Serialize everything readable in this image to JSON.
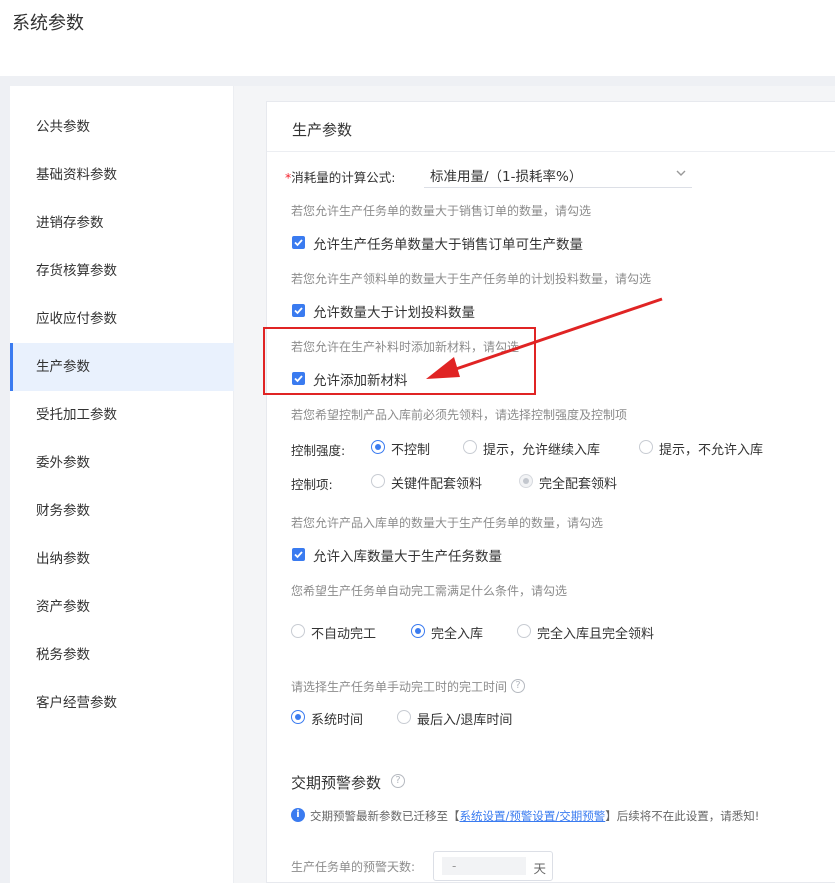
{
  "page_title": "系统参数",
  "sidebar": {
    "items": [
      {
        "label": "公共参数"
      },
      {
        "label": "基础资料参数"
      },
      {
        "label": "进销存参数"
      },
      {
        "label": "存货核算参数"
      },
      {
        "label": "应收应付参数"
      },
      {
        "label": "生产参数"
      },
      {
        "label": "受托加工参数"
      },
      {
        "label": "委外参数"
      },
      {
        "label": "财务参数"
      },
      {
        "label": "出纳参数"
      },
      {
        "label": "资产参数"
      },
      {
        "label": "税务参数"
      },
      {
        "label": "客户经营参数"
      }
    ],
    "active_label": "生产参数"
  },
  "panel": {
    "title": "生产参数",
    "formula": {
      "required_mark": "*",
      "label": "消耗量的计算公式:",
      "value": "标准用量/（1-损耗率%）"
    },
    "hint1": "若您允许生产任务单的数量大于销售订单的数量，请勾选",
    "check1": {
      "label": "允许生产任务单数量大于销售订单可生产数量",
      "checked": true
    },
    "hint2": "若您允许生产领料单的数量大于生产任务单的计划投料数量，请勾选",
    "check2": {
      "label": "允许数量大于计划投料数量",
      "checked": true
    },
    "hint3": "若您允许在生产补料时添加新材料，请勾选",
    "check3": {
      "label": "允许添加新材料",
      "checked": true
    },
    "hint4": "若您希望控制产品入库前必须先领料，请选择控制强度及控制项",
    "control_strength": {
      "label": "控制强度:",
      "options": [
        "不控制",
        "提示，允许继续入库",
        "提示，不允许入库"
      ],
      "selected": "不控制"
    },
    "control_item": {
      "label": "控制项:",
      "options": [
        "关键件配套领料",
        "完全配套领料"
      ],
      "selected": "完全配套领料"
    },
    "hint5": "若您允许产品入库单的数量大于生产任务单的数量，请勾选",
    "check4": {
      "label": "允许入库数量大于生产任务数量",
      "checked": true
    },
    "hint6": "您希望生产任务单自动完工需满足什么条件，请勾选",
    "auto_complete": {
      "options": [
        "不自动完工",
        "完全入库",
        "完全入库且完全领料"
      ],
      "selected": "完全入库"
    },
    "hint7": "请选择生产任务单手动完工时的完工时间",
    "manual_complete": {
      "options": [
        "系统时间",
        "最后入/退库时间"
      ],
      "selected": "系统时间"
    },
    "delivery_section": {
      "title": "交期预警参数",
      "info_prefix": "交期预警最新参数已迁移至【",
      "info_link": "系统设置/预警设置/交期预警",
      "info_suffix": "】后续将不在此设置，请悉知!",
      "days_label": "生产任务单的预警天数:",
      "days_value": "-",
      "days_unit": "天"
    }
  },
  "colors": {
    "accent": "#3a7bf0",
    "annotation_red": "#e02424"
  }
}
